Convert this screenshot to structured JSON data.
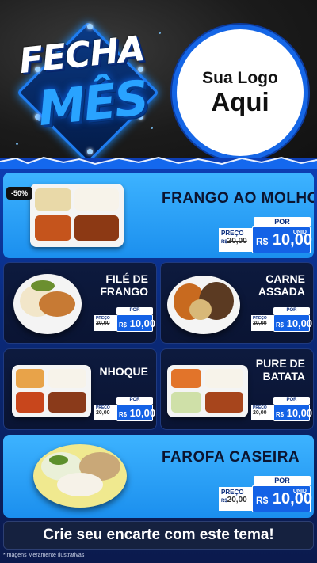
{
  "header": {
    "badge_line1": "FECHA",
    "badge_line2": "MÊS",
    "logo_line1": "Sua Logo",
    "logo_line2": "Aqui"
  },
  "discount_badge": "-50%",
  "price_labels": {
    "por": "POR",
    "preco": "PREÇO",
    "cur": "R$",
    "unid": "UNID",
    "old_prefix": "R$"
  },
  "products": [
    {
      "name": "FRANGO AO MOLHO",
      "old_price": "20,00",
      "new_price": "10,00"
    },
    {
      "name_l1": "FILÉ DE",
      "name_l2": "FRANGO",
      "old_price": "20,00",
      "new_price": "10,00"
    },
    {
      "name_l1": "CARNE",
      "name_l2": "ASSADA",
      "old_price": "20,00",
      "new_price": "10,00"
    },
    {
      "name_l1": "NHOQUE",
      "old_price": "20,00",
      "new_price": "10,00"
    },
    {
      "name_l1": "PURE DE",
      "name_l2": "BATATA",
      "old_price": "20,00",
      "new_price": "10,00"
    },
    {
      "name": "FAROFA CASEIRA",
      "old_price": "20,00",
      "new_price": "10,00"
    }
  ],
  "cta": "Crie seu encarte com este tema!",
  "disclaimer": "*Imagens Meramente Ilustrativas",
  "colors": {
    "accent": "#1462e6",
    "light_card": "#3db3ff",
    "dark_card": "#0d1a3e"
  }
}
